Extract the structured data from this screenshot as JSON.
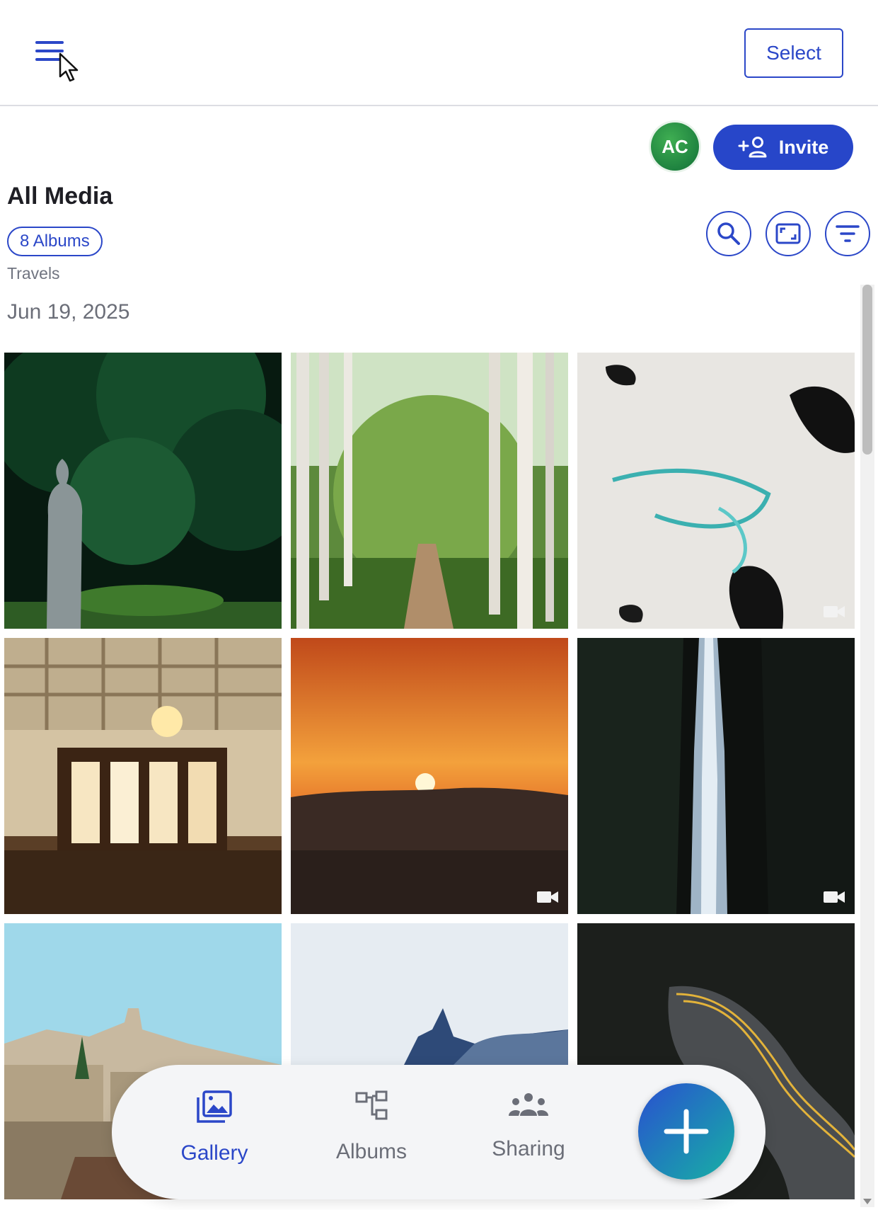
{
  "header": {
    "select_label": "Select"
  },
  "owner": {
    "initials": "AC",
    "invite_label": "Invite"
  },
  "page": {
    "title": "All Media",
    "albums_chip": "8 Albums",
    "album_name": "Travels",
    "date": "Jun 19, 2025"
  },
  "toolbar": {
    "icons": [
      "search-icon",
      "expand-icon",
      "filter-icon"
    ]
  },
  "grid": {
    "tiles": [
      {
        "subject": "stone statue in forest",
        "video": false
      },
      {
        "subject": "birch forest path",
        "video": false
      },
      {
        "subject": "aerial snow landscape",
        "video": true
      },
      {
        "subject": "ornate hall with chandelier",
        "video": false
      },
      {
        "subject": "sunset over hills",
        "video": true
      },
      {
        "subject": "waterfall",
        "video": true
      },
      {
        "subject": "hillside village",
        "video": false
      },
      {
        "subject": "mountain peak in clouds",
        "video": false
      },
      {
        "subject": "winding road",
        "video": false
      }
    ]
  },
  "nav": {
    "items": [
      {
        "label": "Gallery",
        "icon": "gallery-icon",
        "active": true
      },
      {
        "label": "Albums",
        "icon": "albums-icon",
        "active": false
      },
      {
        "label": "Sharing",
        "icon": "sharing-icon",
        "active": false
      }
    ],
    "fab_icon": "plus-icon"
  },
  "colors": {
    "accent": "#2b47c8",
    "nav_inactive": "#6b6e78"
  }
}
